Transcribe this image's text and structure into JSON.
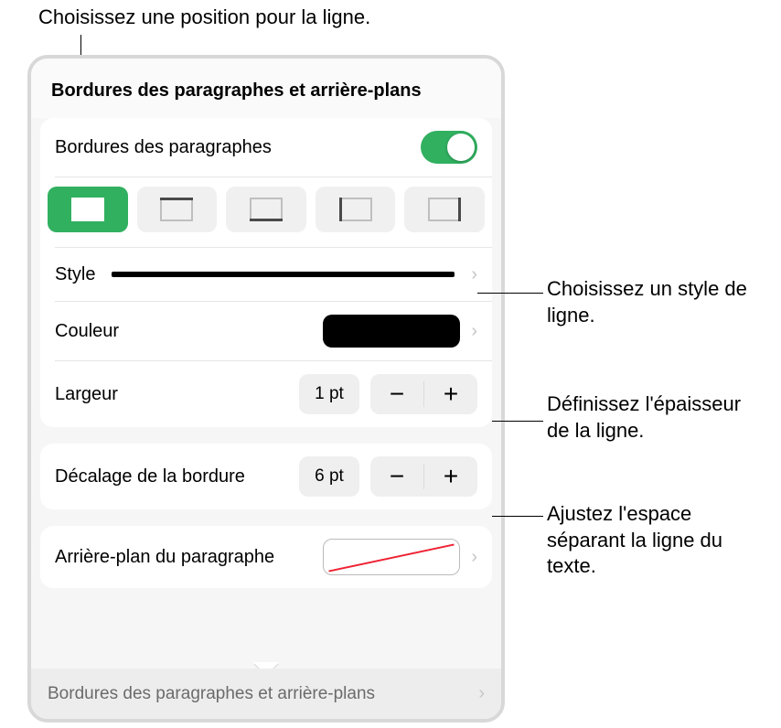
{
  "callouts": {
    "top": "Choisissez une position pour la ligne.",
    "style": "Choisissez un style de ligne.",
    "width": "Définissez l'épaisseur de la ligne.",
    "offset": "Ajustez l'espace séparant la ligne du texte."
  },
  "panel": {
    "title": "Bordures des paragraphes et arrière-plans",
    "toggle": {
      "label": "Bordures des paragraphes",
      "on": true
    },
    "positions": {
      "selected": 0
    },
    "rows": {
      "style": {
        "label": "Style"
      },
      "color": {
        "label": "Couleur",
        "value": "#000000"
      },
      "width": {
        "label": "Largeur",
        "value": "1 pt"
      },
      "offset": {
        "label": "Décalage de la bordure",
        "value": "6 pt"
      },
      "background": {
        "label": "Arrière-plan du paragraphe"
      }
    },
    "footer": "Bordures des paragraphes et arrière-plans"
  }
}
